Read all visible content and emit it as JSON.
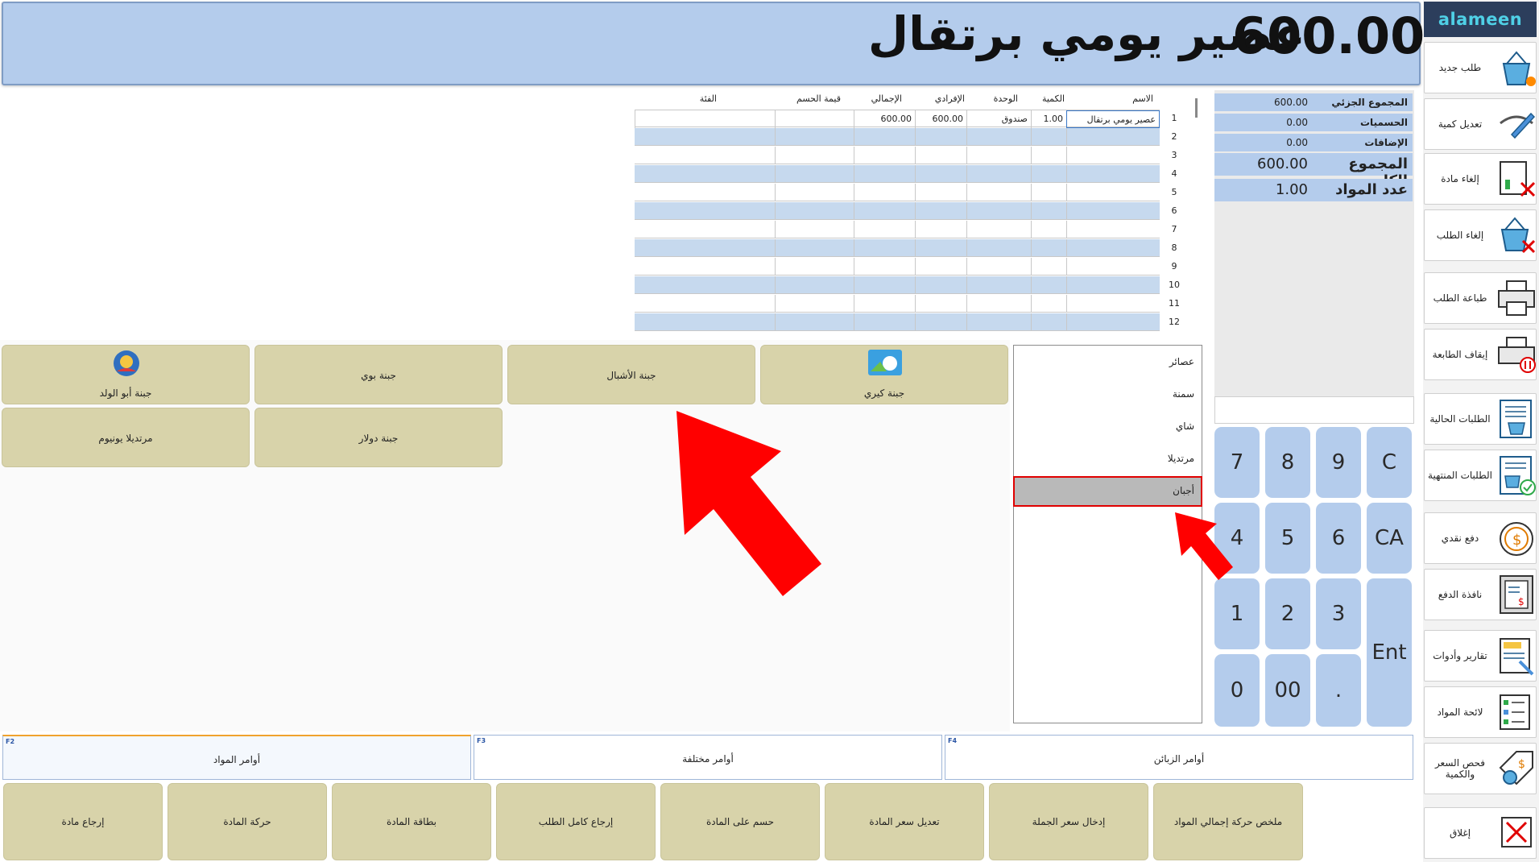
{
  "header": {
    "item_name": "عصير يومي برتقال",
    "amount": "600.00"
  },
  "logo": "alameen",
  "sidebar": {
    "items": [
      {
        "label": "طلب جديد",
        "icon": "basket-new-icon"
      },
      {
        "label": "تعديل كمية",
        "icon": "edit-quantity-icon"
      },
      {
        "label": "إلغاء مادة",
        "icon": "cancel-item-icon"
      },
      {
        "label": "إلغاء الطلب",
        "icon": "cancel-order-icon"
      },
      {
        "label": "طباعة الطلب",
        "icon": "printer-icon"
      },
      {
        "label": "إيقاف الطابعة",
        "icon": "printer-pause-icon"
      },
      {
        "label": "الطلبات الحالية",
        "icon": "current-orders-icon"
      },
      {
        "label": "الطلبات المنتهية",
        "icon": "finished-orders-icon"
      },
      {
        "label": "دفع نقدي",
        "icon": "cash-payment-icon"
      },
      {
        "label": "نافذة الدفع",
        "icon": "payment-window-icon"
      },
      {
        "label": "تقارير وأدوات",
        "icon": "reports-tools-icon"
      },
      {
        "label": "لائحة المواد",
        "icon": "items-list-icon"
      },
      {
        "label": "فحص السعر والكمية",
        "icon": "price-check-icon"
      },
      {
        "label": "إغلاق",
        "icon": "close-icon"
      }
    ]
  },
  "totals": {
    "subtotal_label": "المجموع الجزئي",
    "subtotal": "600.00",
    "discounts_label": "الحسميات",
    "discounts": "0.00",
    "additions_label": "الإضافات",
    "additions": "0.00",
    "grand_total_label": "المجموع الكلي",
    "grand_total": "600.00",
    "item_count_label": "عدد المواد",
    "item_count": "1.00"
  },
  "numpad": [
    "7",
    "8",
    "9",
    "C",
    "4",
    "5",
    "6",
    "CA",
    "1",
    "2",
    "3",
    "Ent",
    "0",
    "00",
    "."
  ],
  "grid": {
    "columns": [
      "الاسم",
      "الكمية",
      "الوحدة",
      "الإفرادي",
      "الإجمالي",
      "قيمة الحسم",
      "الفئة"
    ],
    "rows": [
      {
        "name": "عصير يومي برتقال",
        "qty": "1.00",
        "unit": "صندوق",
        "unit_price": "600.00",
        "total": "600.00",
        "discount": "",
        "category": ""
      }
    ],
    "row_numbers": [
      "1",
      "2",
      "3",
      "4",
      "5",
      "6",
      "7",
      "8",
      "9",
      "10",
      "11",
      "12"
    ]
  },
  "products": [
    {
      "label": "جبنة كيري",
      "icon": "cheese-kiri-icon"
    },
    {
      "label": "جبنة الأشبال",
      "icon": ""
    },
    {
      "label": "جبنة بوي",
      "icon": ""
    },
    {
      "label": "جبنة أبو الولد",
      "icon": "cheese-abu-alwalad-icon"
    },
    {
      "label": "جبنة دولار",
      "icon": ""
    },
    {
      "label": "مرتديلا يونيوم",
      "icon": ""
    }
  ],
  "categories": [
    "عصائر",
    "سمنة",
    "شاي",
    "مرتديلا",
    "أجبان"
  ],
  "selected_category": "أجبان",
  "tabs": [
    {
      "key": "F2",
      "label": "أوامر المواد"
    },
    {
      "key": "F3",
      "label": "أوامر مختلفة"
    },
    {
      "key": "F4",
      "label": "أوامر الزبائن"
    }
  ],
  "actions": [
    "إرجاع مادة",
    "حركة المادة",
    "بطاقة المادة",
    "إرجاع كامل الطلب",
    "حسم على المادة",
    "تعديل سعر المادة",
    "إدخال سعر الجملة",
    "ملخص حركة إجمالي المواد"
  ],
  "colors": {
    "accent_blue": "#b4ccec",
    "tile_beige": "#d8d3aa",
    "highlight_red": "#e00000"
  }
}
